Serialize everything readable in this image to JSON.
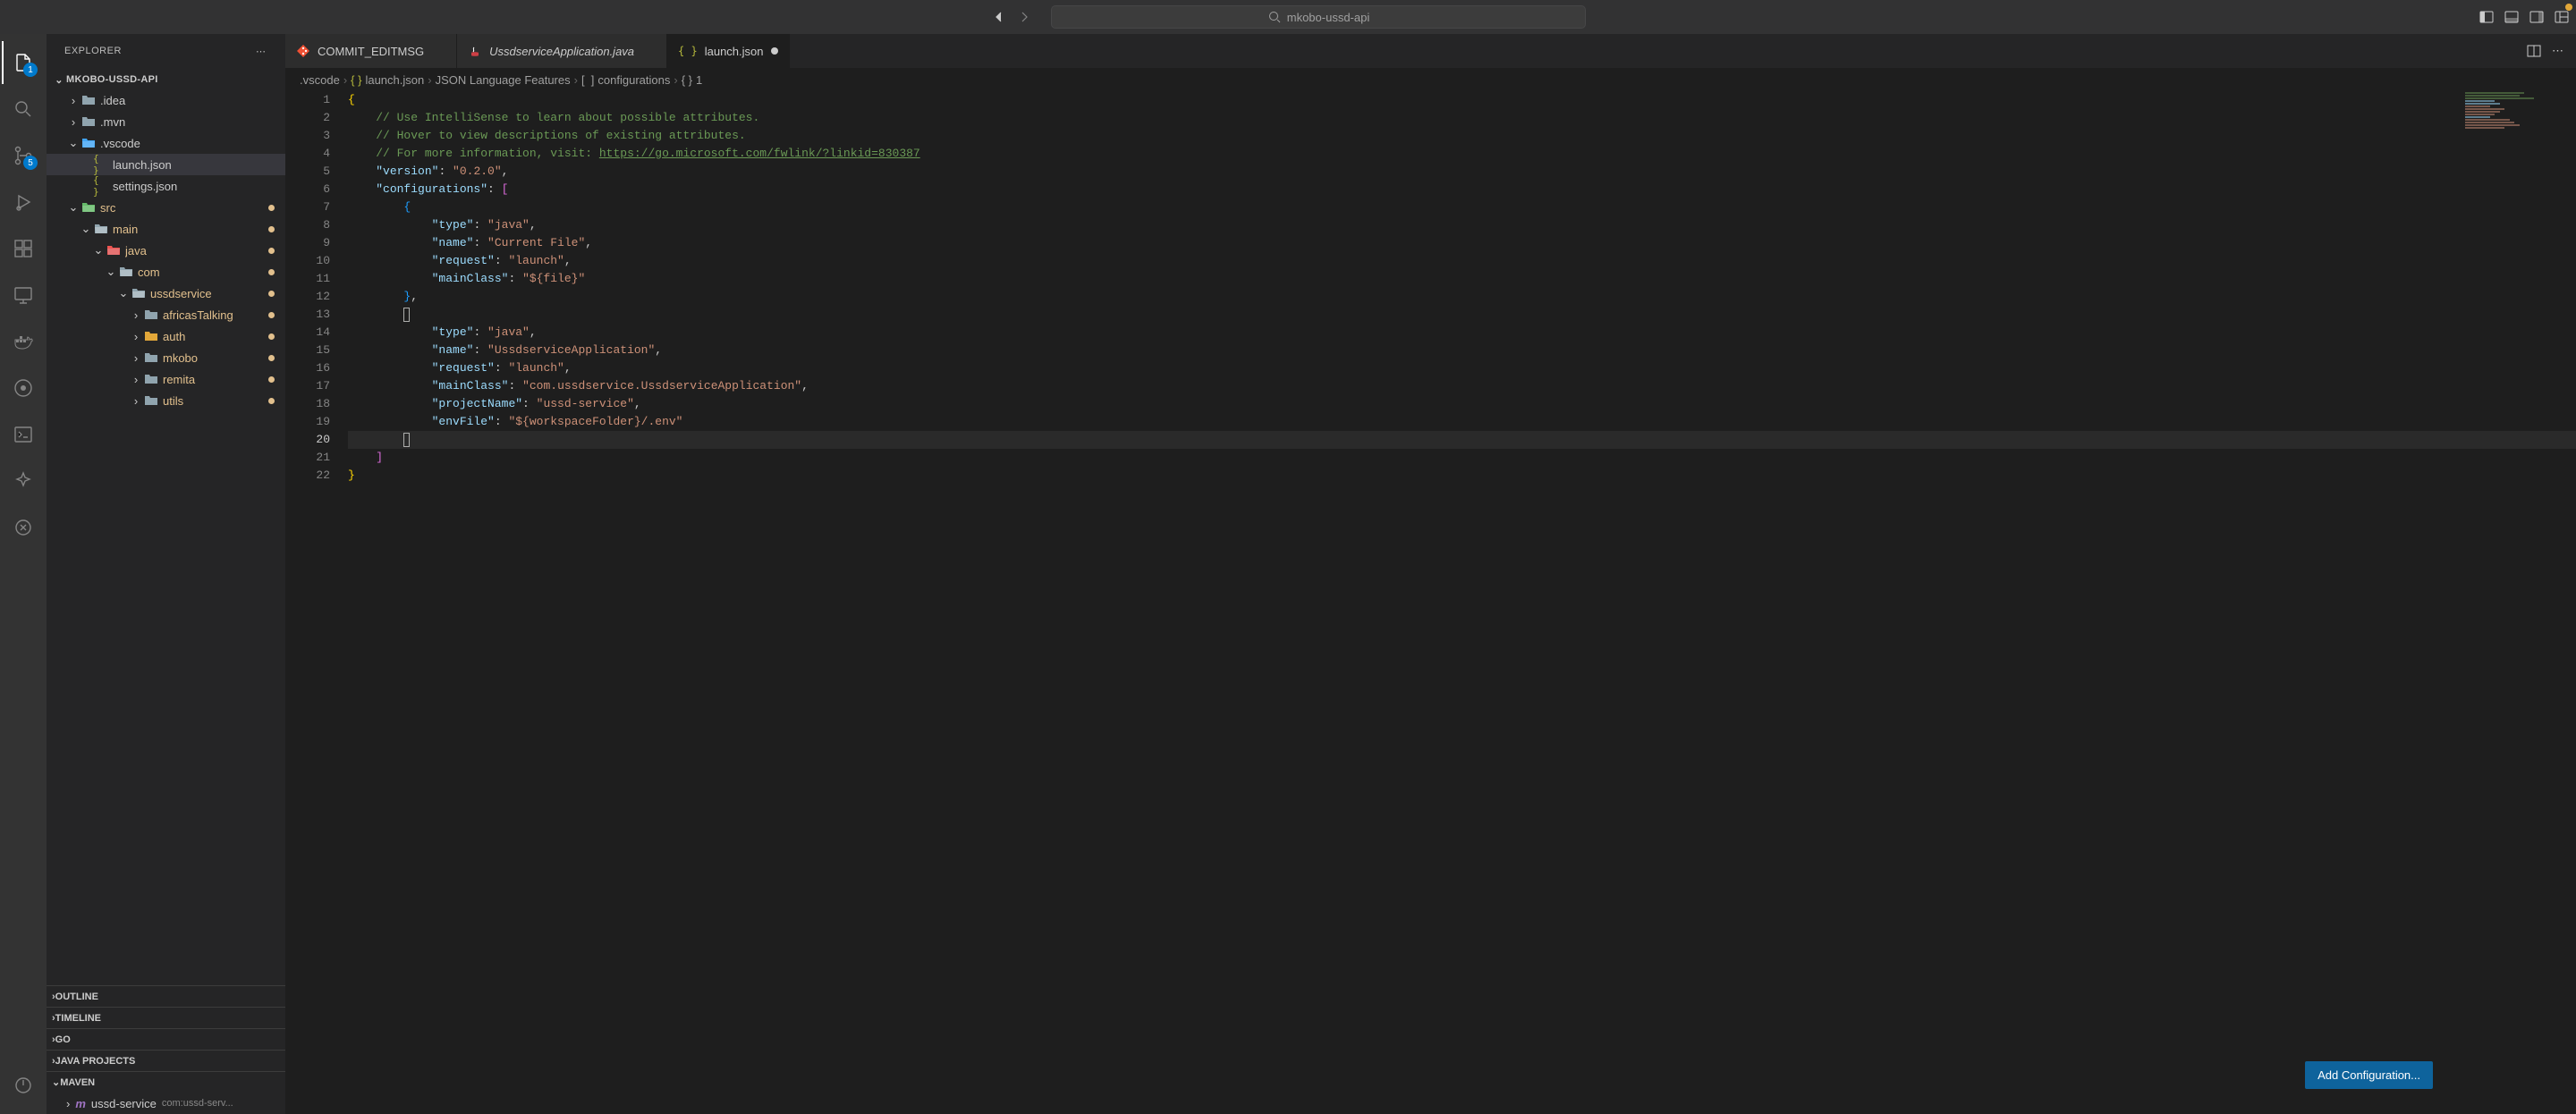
{
  "titlebar": {
    "search_text": "mkobo-ussd-api"
  },
  "sidebar": {
    "title": "EXPLORER",
    "workspace": "MKOBO-USSD-API",
    "tree": [
      {
        "label": ".idea",
        "depth": 1,
        "kind": "folder-closed",
        "chev": "right"
      },
      {
        "label": ".mvn",
        "depth": 1,
        "kind": "folder-closed",
        "chev": "right"
      },
      {
        "label": ".vscode",
        "depth": 1,
        "kind": "folder-open-blue",
        "chev": "down"
      },
      {
        "label": "launch.json",
        "depth": 2,
        "kind": "json",
        "chev": "",
        "selected": true
      },
      {
        "label": "settings.json",
        "depth": 2,
        "kind": "json",
        "chev": ""
      },
      {
        "label": "src",
        "depth": 1,
        "kind": "folder-open-green",
        "chev": "down",
        "modified": true
      },
      {
        "label": "main",
        "depth": 2,
        "kind": "folder-open",
        "chev": "down",
        "modified": true
      },
      {
        "label": "java",
        "depth": 3,
        "kind": "folder-open-red",
        "chev": "down",
        "modified": true
      },
      {
        "label": "com",
        "depth": 4,
        "kind": "folder-open",
        "chev": "down",
        "modified": true
      },
      {
        "label": "ussdservice",
        "depth": 5,
        "kind": "folder-open",
        "chev": "down",
        "modified": true
      },
      {
        "label": "africasTalking",
        "depth": 6,
        "kind": "folder-closed",
        "chev": "right",
        "modified": true
      },
      {
        "label": "auth",
        "depth": 6,
        "kind": "folder-closed-orange",
        "chev": "right",
        "modified": true
      },
      {
        "label": "mkobo",
        "depth": 6,
        "kind": "folder-closed",
        "chev": "right",
        "modified": true
      },
      {
        "label": "remita",
        "depth": 6,
        "kind": "folder-closed",
        "chev": "right",
        "modified": true
      },
      {
        "label": "utils",
        "depth": 6,
        "kind": "folder-closed",
        "chev": "right",
        "modified": true
      }
    ],
    "sections": {
      "outline": "OUTLINE",
      "timeline": "TIMELINE",
      "go": "GO",
      "java_projects": "JAVA PROJECTS",
      "maven": "MAVEN"
    },
    "maven_item": {
      "name": "ussd-service",
      "sub": "com:ussd-serv..."
    }
  },
  "tabs": [
    {
      "label": "COMMIT_EDITMSG",
      "icon": "git",
      "color": "#f05033"
    },
    {
      "label": "UssdserviceApplication.java",
      "icon": "java",
      "italic": true,
      "color": "#cc3e44"
    },
    {
      "label": "launch.json",
      "icon": "json",
      "active": true,
      "dirty": true,
      "color": "#b4b73b"
    }
  ],
  "breadcrumbs": [
    {
      "text": ".vscode",
      "icon": ""
    },
    {
      "text": "launch.json",
      "icon": "json"
    },
    {
      "text": "JSON Language Features",
      "icon": ""
    },
    {
      "text": "configurations",
      "icon": "array"
    },
    {
      "text": "1",
      "icon": "object"
    }
  ],
  "editor": {
    "active_line": 20,
    "add_config_label": "Add Configuration...",
    "lines": [
      {
        "n": 1,
        "tokens": [
          [
            "{",
            "c-brace"
          ]
        ]
      },
      {
        "n": 2,
        "tokens": [
          [
            "    ",
            ""
          ],
          [
            "// Use IntelliSense to learn about possible attributes.",
            "c-comment"
          ]
        ]
      },
      {
        "n": 3,
        "tokens": [
          [
            "    ",
            ""
          ],
          [
            "// Hover to view descriptions of existing attributes.",
            "c-comment"
          ]
        ]
      },
      {
        "n": 4,
        "tokens": [
          [
            "    ",
            ""
          ],
          [
            "// For more information, visit: ",
            "c-comment"
          ],
          [
            "https://go.microsoft.com/fwlink/?linkid=830387",
            "c-link"
          ]
        ]
      },
      {
        "n": 5,
        "tokens": [
          [
            "    ",
            ""
          ],
          [
            "\"version\"",
            "c-key"
          ],
          [
            ": ",
            "c-punct"
          ],
          [
            "\"0.2.0\"",
            "c-string"
          ],
          [
            ",",
            "c-punct"
          ]
        ]
      },
      {
        "n": 6,
        "tokens": [
          [
            "    ",
            ""
          ],
          [
            "\"configurations\"",
            "c-key"
          ],
          [
            ": ",
            "c-punct"
          ],
          [
            "[",
            "c-brace2"
          ]
        ]
      },
      {
        "n": 7,
        "tokens": [
          [
            "        ",
            ""
          ],
          [
            "{",
            "c-brace3"
          ]
        ]
      },
      {
        "n": 8,
        "tokens": [
          [
            "            ",
            ""
          ],
          [
            "\"type\"",
            "c-key"
          ],
          [
            ": ",
            "c-punct"
          ],
          [
            "\"java\"",
            "c-string"
          ],
          [
            ",",
            "c-punct"
          ]
        ]
      },
      {
        "n": 9,
        "tokens": [
          [
            "            ",
            ""
          ],
          [
            "\"name\"",
            "c-key"
          ],
          [
            ": ",
            "c-punct"
          ],
          [
            "\"Current File\"",
            "c-string"
          ],
          [
            ",",
            "c-punct"
          ]
        ]
      },
      {
        "n": 10,
        "tokens": [
          [
            "            ",
            ""
          ],
          [
            "\"request\"",
            "c-key"
          ],
          [
            ": ",
            "c-punct"
          ],
          [
            "\"launch\"",
            "c-string"
          ],
          [
            ",",
            "c-punct"
          ]
        ]
      },
      {
        "n": 11,
        "tokens": [
          [
            "            ",
            ""
          ],
          [
            "\"mainClass\"",
            "c-key"
          ],
          [
            ": ",
            "c-punct"
          ],
          [
            "\"${file}\"",
            "c-string"
          ]
        ]
      },
      {
        "n": 12,
        "tokens": [
          [
            "        ",
            ""
          ],
          [
            "}",
            "c-brace3"
          ],
          [
            ",",
            "c-punct"
          ]
        ]
      },
      {
        "n": 13,
        "tokens": [
          [
            "        ",
            ""
          ]
        ],
        "cursor13": true
      },
      {
        "n": 14,
        "tokens": [
          [
            "            ",
            ""
          ],
          [
            "\"type\"",
            "c-key"
          ],
          [
            ": ",
            "c-punct"
          ],
          [
            "\"java\"",
            "c-string"
          ],
          [
            ",",
            "c-punct"
          ]
        ]
      },
      {
        "n": 15,
        "tokens": [
          [
            "            ",
            ""
          ],
          [
            "\"name\"",
            "c-key"
          ],
          [
            ": ",
            "c-punct"
          ],
          [
            "\"UssdserviceApplication\"",
            "c-string"
          ],
          [
            ",",
            "c-punct"
          ]
        ]
      },
      {
        "n": 16,
        "tokens": [
          [
            "            ",
            ""
          ],
          [
            "\"request\"",
            "c-key"
          ],
          [
            ": ",
            "c-punct"
          ],
          [
            "\"launch\"",
            "c-string"
          ],
          [
            ",",
            "c-punct"
          ]
        ]
      },
      {
        "n": 17,
        "tokens": [
          [
            "            ",
            ""
          ],
          [
            "\"mainClass\"",
            "c-key"
          ],
          [
            ": ",
            "c-punct"
          ],
          [
            "\"com.ussdservice.UssdserviceApplication\"",
            "c-string"
          ],
          [
            ",",
            "c-punct"
          ]
        ]
      },
      {
        "n": 18,
        "tokens": [
          [
            "            ",
            ""
          ],
          [
            "\"projectName\"",
            "c-key"
          ],
          [
            ": ",
            "c-punct"
          ],
          [
            "\"ussd-service\"",
            "c-string"
          ],
          [
            ",",
            "c-punct"
          ]
        ]
      },
      {
        "n": 19,
        "tokens": [
          [
            "            ",
            ""
          ],
          [
            "\"envFile\"",
            "c-key"
          ],
          [
            ": ",
            "c-punct"
          ],
          [
            "\"${workspaceFolder}/.env\"",
            "c-string"
          ]
        ]
      },
      {
        "n": 20,
        "tokens": [
          [
            "        ",
            ""
          ]
        ],
        "hl": true,
        "cursor20": true
      },
      {
        "n": 21,
        "tokens": [
          [
            "    ",
            ""
          ],
          [
            "]",
            "c-brace2"
          ]
        ]
      },
      {
        "n": 22,
        "tokens": [
          [
            "}",
            "c-brace"
          ]
        ]
      }
    ]
  },
  "activity_badges": {
    "explorer": "1",
    "scm": "5"
  }
}
